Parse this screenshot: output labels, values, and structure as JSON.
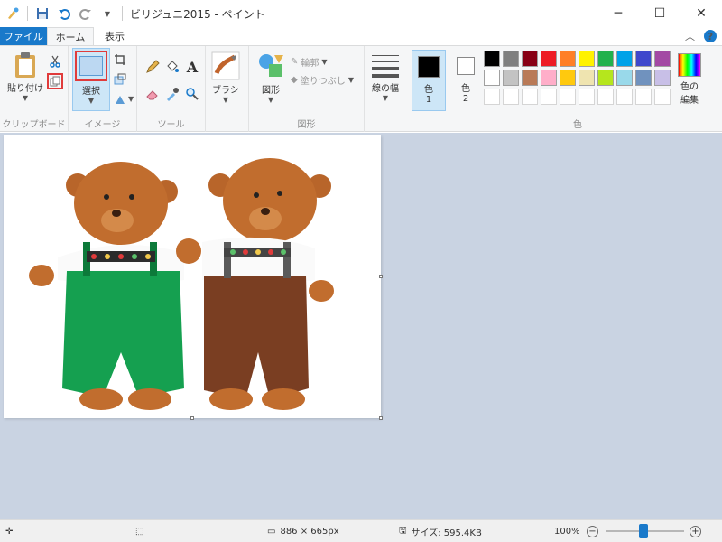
{
  "window": {
    "title": "ビリジュニ2015 - ペイント"
  },
  "tabs": {
    "file": "ファイル",
    "home": "ホーム",
    "view": "表示"
  },
  "ribbon": {
    "clipboard": {
      "paste": "貼り付け",
      "group": "クリップボード"
    },
    "image": {
      "select": "選択",
      "group": "イメージ"
    },
    "tools": {
      "group": "ツール"
    },
    "brushes": {
      "label": "ブラシ"
    },
    "shapes": {
      "label": "図形",
      "outline": "輪郭",
      "fill": "塗りつぶし",
      "group": "図形"
    },
    "size": {
      "label": "線の幅"
    },
    "colors": {
      "color1": "色",
      "color1_num": "1",
      "color2": "色",
      "color2_num": "2",
      "edit": "色の",
      "edit2": "編集",
      "group": "色"
    }
  },
  "palette": {
    "row1": [
      "#000000",
      "#7f7f7f",
      "#880015",
      "#ed1c24",
      "#ff7f27",
      "#fff200",
      "#22b14c",
      "#00a2e8",
      "#3f48cc",
      "#a349a4"
    ],
    "row2": [
      "#ffffff",
      "#c3c3c3",
      "#b97a57",
      "#ffaec9",
      "#ffc90e",
      "#efe4b0",
      "#b5e61d",
      "#99d9ea",
      "#7092be",
      "#c8bfe7"
    ],
    "row3": [
      "#ffffff",
      "#ffffff",
      "#ffffff",
      "#ffffff",
      "#ffffff",
      "#ffffff",
      "#ffffff",
      "#ffffff",
      "#ffffff",
      "#ffffff"
    ]
  },
  "status": {
    "dimensions": "886 × 665px",
    "filesize": "サイズ: 595.4KB",
    "zoom": "100%"
  },
  "colors": {
    "accent": "#1979ca",
    "workspace": "#c9d3e2",
    "ribbon": "#f5f6f7"
  }
}
